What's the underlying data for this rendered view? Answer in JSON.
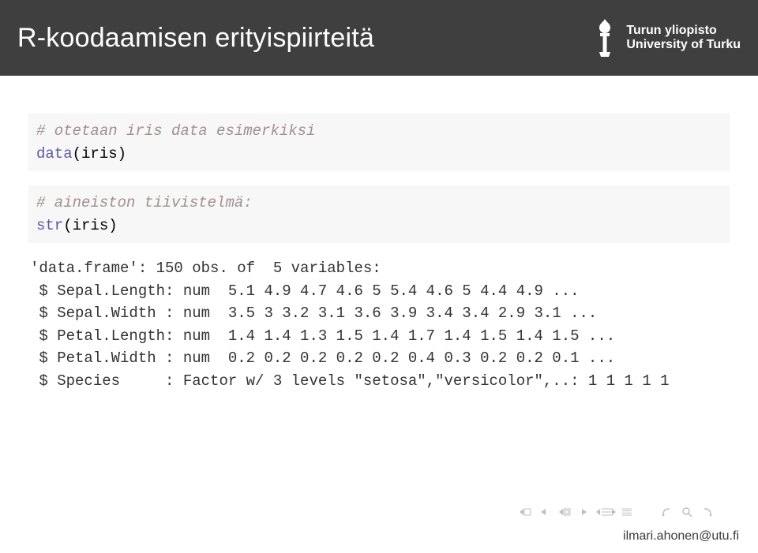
{
  "header": {
    "title": "R-koodaamisen erityispiirteitä",
    "uni_fi": "Turun yliopisto",
    "uni_en": "University of Turku"
  },
  "code": {
    "comment1": "# otetaan iris data esimerkiksi",
    "line1_call": "data",
    "line1_rest": "(iris)",
    "comment2": "# aineiston tiivistelmä:",
    "line2_call": "str",
    "line2_rest": "(iris)"
  },
  "output": "'data.frame': 150 obs. of  5 variables:\n $ Sepal.Length: num  5.1 4.9 4.7 4.6 5 5.4 4.6 5 4.4 4.9 ...\n $ Sepal.Width : num  3.5 3 3.2 3.1 3.6 3.9 3.4 3.4 2.9 3.1 ...\n $ Petal.Length: num  1.4 1.4 1.3 1.5 1.4 1.7 1.4 1.5 1.4 1.5 ...\n $ Petal.Width : num  0.2 0.2 0.2 0.2 0.2 0.4 0.3 0.2 0.2 0.1 ...\n $ Species     : Factor w/ 3 levels \"setosa\",\"versicolor\",..: 1 1 1 1 1",
  "footer": {
    "email": "ilmari.ahonen@utu.fi"
  }
}
